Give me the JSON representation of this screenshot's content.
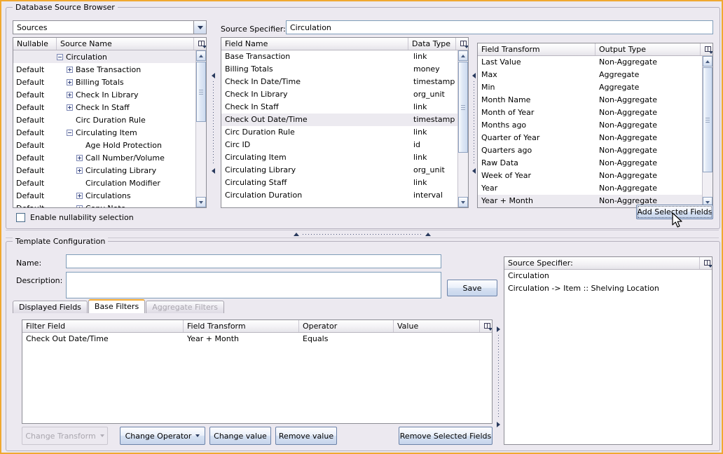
{
  "window": {
    "title": "Database Source Browser"
  },
  "source_browser": {
    "sources_combo": {
      "value": "Sources",
      "icon": "chevron-down-icon"
    },
    "tree": {
      "columns": [
        "Nullable",
        "Source Name"
      ],
      "header_icon": "column-chooser-icon",
      "rows": [
        {
          "nullable": "",
          "name": "Circulation",
          "indent": 0,
          "expander": "minus",
          "selected": true
        },
        {
          "nullable": "Default",
          "name": "Base Transaction",
          "indent": 1,
          "expander": "plus",
          "selected": false
        },
        {
          "nullable": "Default",
          "name": "Billing Totals",
          "indent": 1,
          "expander": "plus",
          "selected": false
        },
        {
          "nullable": "Default",
          "name": "Check In Library",
          "indent": 1,
          "expander": "plus",
          "selected": false
        },
        {
          "nullable": "Default",
          "name": "Check In Staff",
          "indent": 1,
          "expander": "plus",
          "selected": false
        },
        {
          "nullable": "Default",
          "name": "Circ Duration Rule",
          "indent": 1,
          "expander": "none",
          "selected": false
        },
        {
          "nullable": "Default",
          "name": "Circulating Item",
          "indent": 1,
          "expander": "minus",
          "selected": false
        },
        {
          "nullable": "Default",
          "name": "Age Hold Protection",
          "indent": 2,
          "expander": "none",
          "selected": false
        },
        {
          "nullable": "Default",
          "name": "Call Number/Volume",
          "indent": 2,
          "expander": "plus",
          "selected": false
        },
        {
          "nullable": "Default",
          "name": "Circulating Library",
          "indent": 2,
          "expander": "plus",
          "selected": false
        },
        {
          "nullable": "Default",
          "name": "Circulation Modifier",
          "indent": 2,
          "expander": "none",
          "selected": false
        },
        {
          "nullable": "Default",
          "name": "Circulations",
          "indent": 2,
          "expander": "plus",
          "selected": false
        },
        {
          "nullable": "Default",
          "name": "Copy Note",
          "indent": 2,
          "expander": "plus",
          "selected": false
        }
      ]
    },
    "nullability_checkbox": {
      "label": "Enable nullability selection",
      "checked": false
    }
  },
  "specifier": {
    "label": "Source Specifier:",
    "value": "Circulation"
  },
  "fields_table": {
    "columns": [
      "Field Name",
      "Data Type"
    ],
    "header_icon": "column-chooser-icon",
    "rows": [
      {
        "name": "Base Transaction",
        "type": "link",
        "selected": false
      },
      {
        "name": "Billing Totals",
        "type": "money",
        "selected": false
      },
      {
        "name": "Check In Date/Time",
        "type": "timestamp",
        "selected": false
      },
      {
        "name": "Check In Library",
        "type": "org_unit",
        "selected": false
      },
      {
        "name": "Check In Staff",
        "type": "link",
        "selected": false
      },
      {
        "name": "Check Out Date/Time",
        "type": "timestamp",
        "selected": true
      },
      {
        "name": "Circ Duration Rule",
        "type": "link",
        "selected": false
      },
      {
        "name": "Circ ID",
        "type": "id",
        "selected": false
      },
      {
        "name": "Circulating Item",
        "type": "link",
        "selected": false
      },
      {
        "name": "Circulating Library",
        "type": "org_unit",
        "selected": false
      },
      {
        "name": "Circulating Staff",
        "type": "link",
        "selected": false
      },
      {
        "name": "Circulation Duration",
        "type": "interval",
        "selected": false
      }
    ]
  },
  "transform_table": {
    "columns": [
      "Field Transform",
      "Output Type"
    ],
    "header_icon": "column-chooser-icon",
    "rows": [
      {
        "transform": "Last Value",
        "output": "Non-Aggregate",
        "selected": false
      },
      {
        "transform": "Max",
        "output": "Aggregate",
        "selected": false
      },
      {
        "transform": "Min",
        "output": "Aggregate",
        "selected": false
      },
      {
        "transform": "Month Name",
        "output": "Non-Aggregate",
        "selected": false
      },
      {
        "transform": "Month of Year",
        "output": "Non-Aggregate",
        "selected": false
      },
      {
        "transform": "Months ago",
        "output": "Non-Aggregate",
        "selected": false
      },
      {
        "transform": "Quarter of Year",
        "output": "Non-Aggregate",
        "selected": false
      },
      {
        "transform": "Quarters ago",
        "output": "Non-Aggregate",
        "selected": false
      },
      {
        "transform": "Raw Data",
        "output": "Non-Aggregate",
        "selected": false
      },
      {
        "transform": "Week of Year",
        "output": "Non-Aggregate",
        "selected": false
      },
      {
        "transform": "Year",
        "output": "Non-Aggregate",
        "selected": false
      },
      {
        "transform": "Year + Month",
        "output": "Non-Aggregate",
        "selected": true
      }
    ]
  },
  "add_selected_fields_button": "Add Selected Fields",
  "template_config": {
    "title": "Template Configuration",
    "name_label": "Name:",
    "name_value": "",
    "description_label": "Description:",
    "description_value": "",
    "save_button": "Save",
    "tabs": [
      {
        "label": "Displayed Fields",
        "state": "inactive"
      },
      {
        "label": "Base Filters",
        "state": "active"
      },
      {
        "label": "Aggregate Filters",
        "state": "disabled"
      }
    ],
    "filters_table": {
      "columns": [
        "Filter Field",
        "Field Transform",
        "Operator",
        "Value"
      ],
      "header_icon": "column-chooser-icon",
      "rows": [
        {
          "field": "Check Out Date/Time",
          "transform": "Year + Month",
          "operator": "Equals",
          "value": ""
        }
      ]
    },
    "buttons": [
      {
        "label": "Change Transform",
        "state": "disabled",
        "caret": true
      },
      {
        "label": "Change Operator",
        "state": "enabled",
        "caret": true
      },
      {
        "label": "Change value",
        "state": "enabled",
        "caret": false
      },
      {
        "label": "Remove value",
        "state": "enabled",
        "caret": false
      },
      {
        "label": "Remove Selected Fields",
        "state": "enabled",
        "caret": false
      }
    ],
    "source_specifier_panel": {
      "header": "Source Specifier:",
      "header_icon": "column-chooser-icon",
      "rows": [
        "Circulation",
        "Circulation -> Item :: Shelving Location"
      ]
    }
  }
}
